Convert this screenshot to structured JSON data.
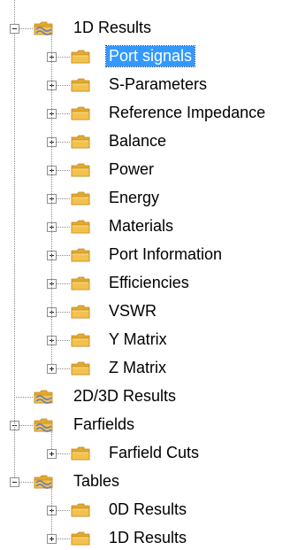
{
  "tree": {
    "results_1d": {
      "label": "1D Results",
      "children": [
        "Port signals",
        "S-Parameters",
        "Reference Impedance",
        "Balance",
        "Power",
        "Energy",
        "Materials",
        "Port Information",
        "Efficiencies",
        "VSWR",
        "Y Matrix",
        "Z Matrix"
      ],
      "selected_child": "Port signals"
    },
    "results_2d3d": {
      "label": "2D/3D Results"
    },
    "farfields": {
      "label": "Farfields",
      "children": [
        "Farfield Cuts"
      ]
    },
    "tables": {
      "label": "Tables",
      "children": [
        "0D Results",
        "1D Results"
      ]
    }
  },
  "icons": {
    "folder": "folder-icon",
    "result_group": "result-group-icon",
    "expand": "plus-expander-icon",
    "collapse": "minus-expander-icon"
  },
  "colors": {
    "selection": "#3399ff",
    "folder": "#f3c24e",
    "group_icon": "#6f7fb2"
  }
}
